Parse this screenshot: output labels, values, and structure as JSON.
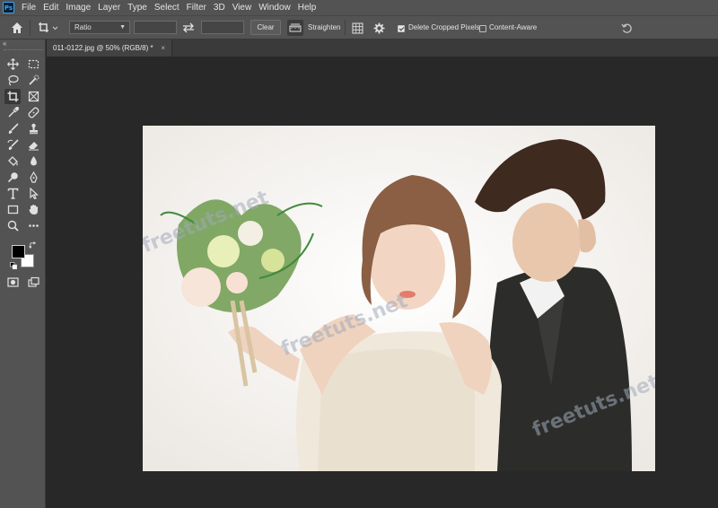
{
  "app": {
    "logo_text": "Ps"
  },
  "menu": [
    "File",
    "Edit",
    "Image",
    "Layer",
    "Type",
    "Select",
    "Filter",
    "3D",
    "View",
    "Window",
    "Help"
  ],
  "options_bar": {
    "ratio_select": "Ratio",
    "ratio_width": "",
    "ratio_height": "",
    "clear_label": "Clear",
    "straighten_label": "Straighten",
    "delete_cropped_label": "Delete Cropped Pixels",
    "delete_cropped_checked": true,
    "content_aware_label": "Content-Aware",
    "content_aware_checked": false
  },
  "toolbar": {
    "collapse_label": "«"
  },
  "document": {
    "tab_title": "011-0122.jpg @ 50% (RGB/8) *",
    "tab_close": "×"
  },
  "watermarks": [
    "freetuts.net",
    "freetuts.net",
    "freetuts.net"
  ],
  "colors": {
    "foreground": "#000000",
    "background": "#ffffff",
    "accent": "#31a8ff"
  }
}
